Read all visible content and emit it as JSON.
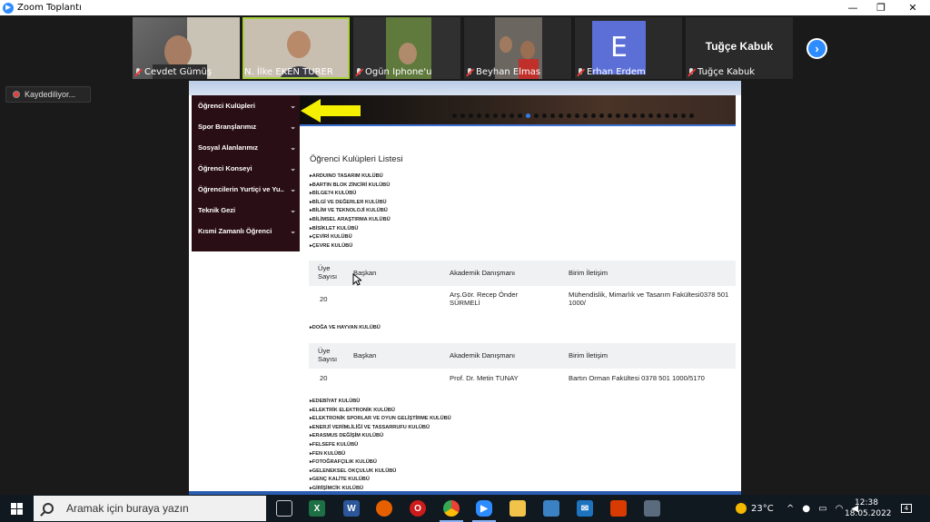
{
  "window": {
    "title": "Zoom Toplantı",
    "min": "—",
    "restore": "❐",
    "close": "✕"
  },
  "participants": [
    {
      "name": "Cevdet Gümüş",
      "muted": true
    },
    {
      "name": "N. İlke EKEN TURER",
      "muted": false,
      "speaking": true
    },
    {
      "name": "Ogün Iphone'u",
      "muted": true
    },
    {
      "name": "Beyhan Elmas",
      "muted": true
    },
    {
      "name": "Erhan Erdem",
      "muted": true,
      "avatar_letter": "E"
    },
    {
      "name": "Tuğçe Kabuk",
      "muted": true,
      "video_off_label": "Tuğçe Kabuk"
    }
  ],
  "next_icon": "›",
  "recording": {
    "label": "Kaydediliyor..."
  },
  "website": {
    "menu": [
      "Öğrenci Kulüpleri",
      "Spor Branşlarımız",
      "Sosyal Alanlarımız",
      "Öğrenci Konseyi",
      "Öğrencilerin Yurtiçi ve Yu..",
      "Teknik Gezi",
      "Kısmi Zamanlı Öğrenci"
    ],
    "menu_chevron": "⌄",
    "slider_dots": 30,
    "slider_active": 9,
    "list_title": "Öğrenci Kulüpleri Listesi",
    "clubs_a": [
      "▸ARDUINO TASARIM KULÜBÜ",
      "▸BARTIN BLOK ZİNCİRİ KULÜBÜ",
      "▸BİLGE74 KULÜBÜ",
      "▸BİLGİ VE DEĞERLER KULÜBÜ",
      "▸BİLİM VE TEKNOLOJİ KULÜBÜ",
      "▸BİLİMSEL ARAŞTIRMA KULÜBÜ",
      "▸BİSİKLET KULÜBÜ",
      "▸ÇEVİRİ KULÜBÜ",
      "▸ÇEVRE KULÜBÜ"
    ],
    "table_headers": {
      "members": "Üye Sayısı",
      "president": "Başkan",
      "advisor": "Akademik Danışmanı",
      "contact": "Birim İletişim"
    },
    "table1_row": {
      "members": "20",
      "president": "",
      "advisor": "Arş.Gör. Recep Önder SÜRMELİ",
      "contact": "Mühendislik, Mimarlık ve Tasarım Fakültesi0378 501 1000/"
    },
    "club_single": "▸DOĞA VE HAYVAN KULÜBÜ",
    "table2_row": {
      "members": "20",
      "president": "",
      "advisor": "Prof. Dr. Metin TUNAY",
      "contact": "Bartın Orman Fakültesi 0378 501 1000/5170"
    },
    "clubs_b": [
      "▸EDEBİYAT KULÜBÜ",
      "▸ELEKTRİK ELEKTRONİK KULÜBÜ",
      "▸ELEKTRONİK SPORLAR VE OYUN GELİŞTİRME KULÜBÜ",
      "▸ENERJİ VERİMLİLİĞİ VE TASSARRUFU KULÜBÜ",
      "▸ERASMUS DEĞİŞİM KULÜBÜ",
      "▸FELSEFE KULÜBÜ",
      "▸FEN KULÜBÜ",
      "▸FOTOĞRAFÇILIK KULÜBÜ",
      "▸GELENEKSEL OKÇULUK KULÜBÜ",
      "▸GENÇ KALİTE KULÜBÜ",
      "▸GİRİŞİMCİK KULÜBÜ"
    ]
  },
  "taskbar": {
    "search_placeholder": "Aramak için buraya yazın",
    "weather": "23°C",
    "time": "12:38",
    "date": "18.05.2022",
    "notifications": "4",
    "accent": "#2d8cff"
  }
}
